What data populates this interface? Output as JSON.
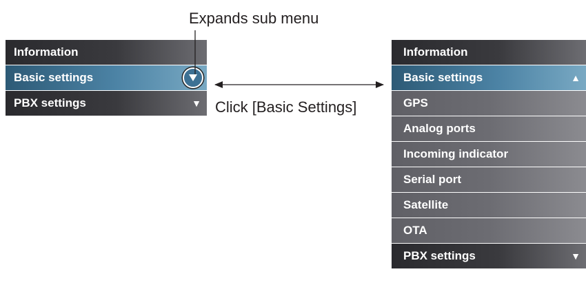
{
  "annotations": {
    "expands": "Expands sub menu",
    "click": "Click [Basic Settings]"
  },
  "left_menu": {
    "items": [
      {
        "label": "Information",
        "state": "dark",
        "arrow": ""
      },
      {
        "label": "Basic settings",
        "state": "active",
        "arrow": "▼"
      },
      {
        "label": "PBX settings",
        "state": "dark",
        "arrow": "▼"
      }
    ]
  },
  "right_menu": {
    "items": [
      {
        "label": "Information",
        "state": "dark",
        "arrow": ""
      },
      {
        "label": "Basic settings",
        "state": "active",
        "arrow": "▲"
      },
      {
        "label": "GPS",
        "state": "sub",
        "arrow": ""
      },
      {
        "label": "Analog ports",
        "state": "sub",
        "arrow": ""
      },
      {
        "label": "Incoming indicator",
        "state": "sub",
        "arrow": ""
      },
      {
        "label": "Serial port",
        "state": "sub",
        "arrow": ""
      },
      {
        "label": "Satellite",
        "state": "sub",
        "arrow": ""
      },
      {
        "label": "OTA",
        "state": "sub",
        "arrow": ""
      },
      {
        "label": "PBX settings",
        "state": "dark",
        "arrow": "▼"
      }
    ]
  },
  "colors": {
    "active": "#4c83a5",
    "dark": "#2a2a2e",
    "sub": "#6c6c72"
  }
}
